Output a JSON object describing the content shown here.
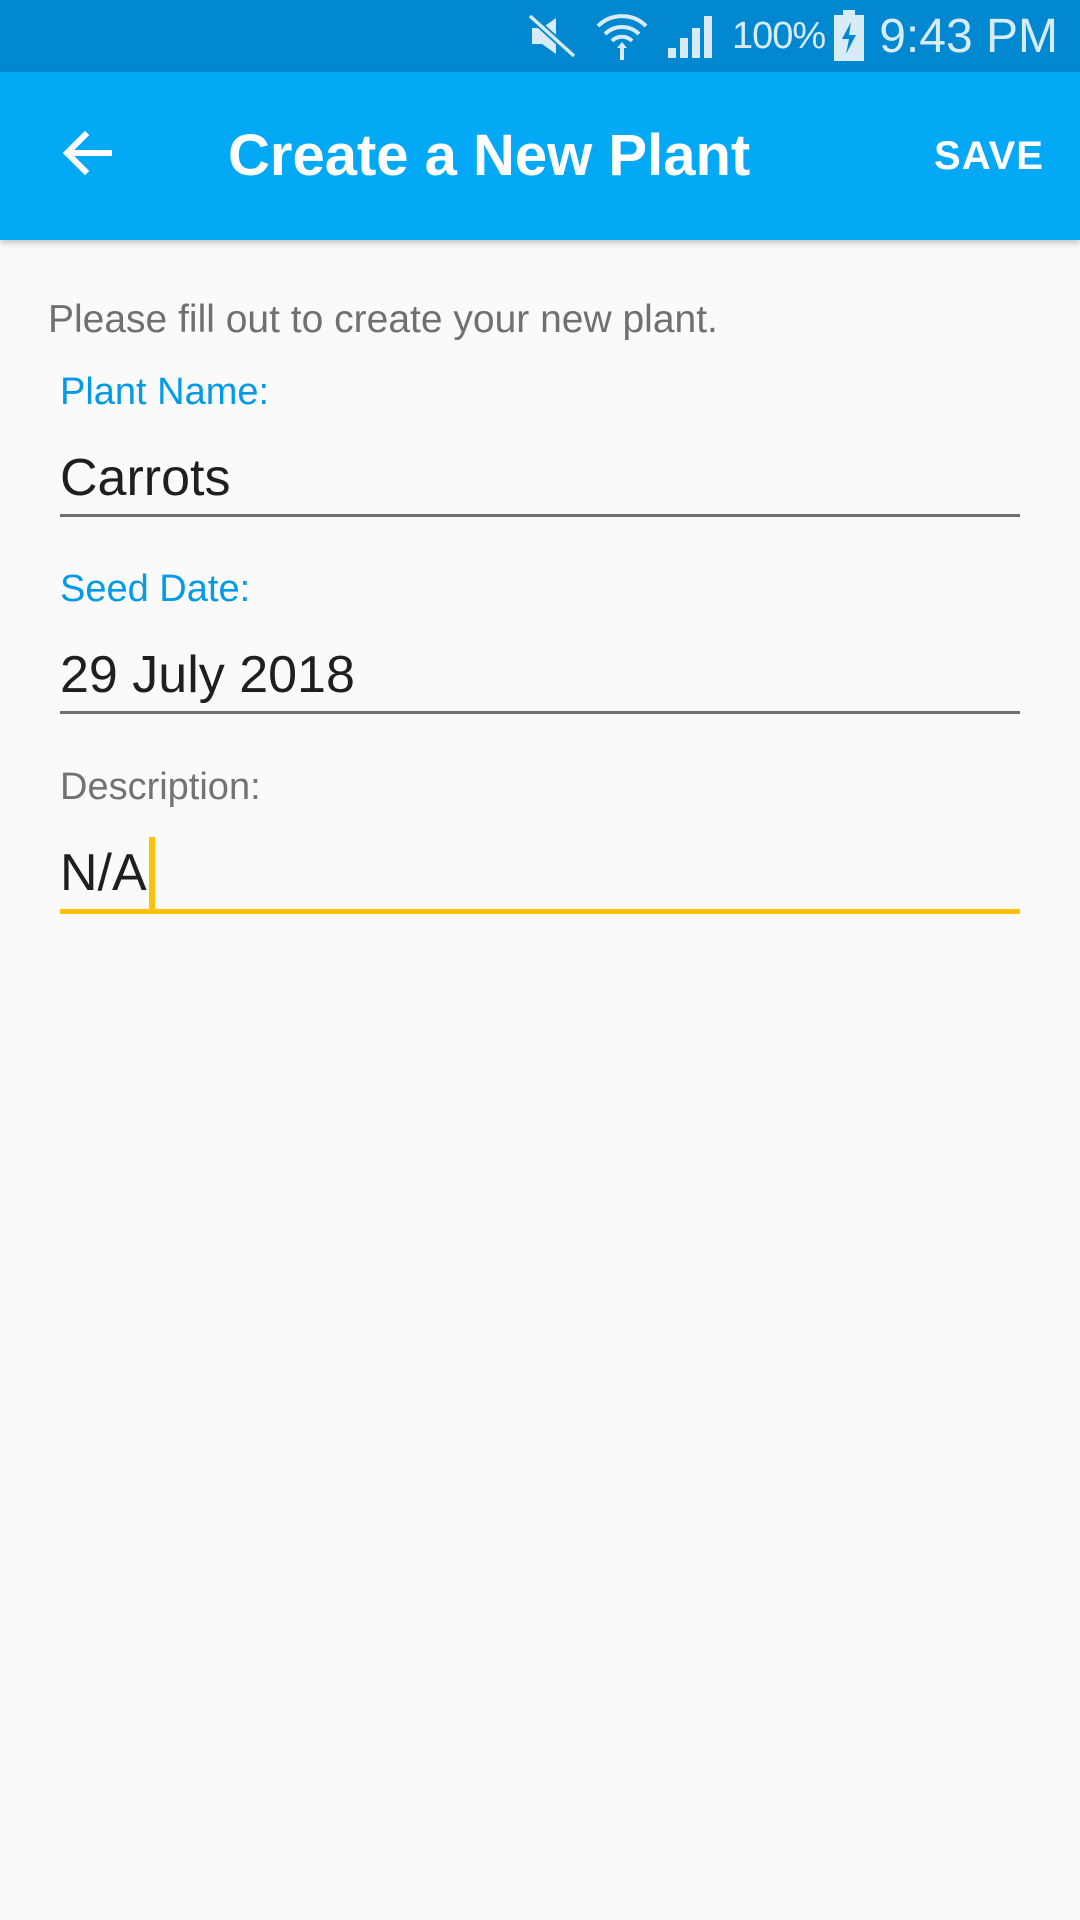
{
  "status_bar": {
    "battery_percent": "100%",
    "time": "9:43 PM",
    "icons": [
      "mute-icon",
      "wifi-icon",
      "signal-icon",
      "battery-charging-icon"
    ],
    "background_color": "#0288d1"
  },
  "app_bar": {
    "back_icon": "arrow-back-icon",
    "title": "Create a New Plant",
    "save_label": "SAVE",
    "background_color": "#03a9f4"
  },
  "form": {
    "intro": "Please fill out to create your new plant.",
    "plant_name": {
      "label": "Plant Name:",
      "value": "Carrots"
    },
    "seed_date": {
      "label": "Seed Date:",
      "value": "29 July 2018"
    },
    "description": {
      "label": "Description:",
      "value": "N/A",
      "focused": true
    },
    "label_color": "#039be5",
    "focus_color": "#ffc107"
  }
}
